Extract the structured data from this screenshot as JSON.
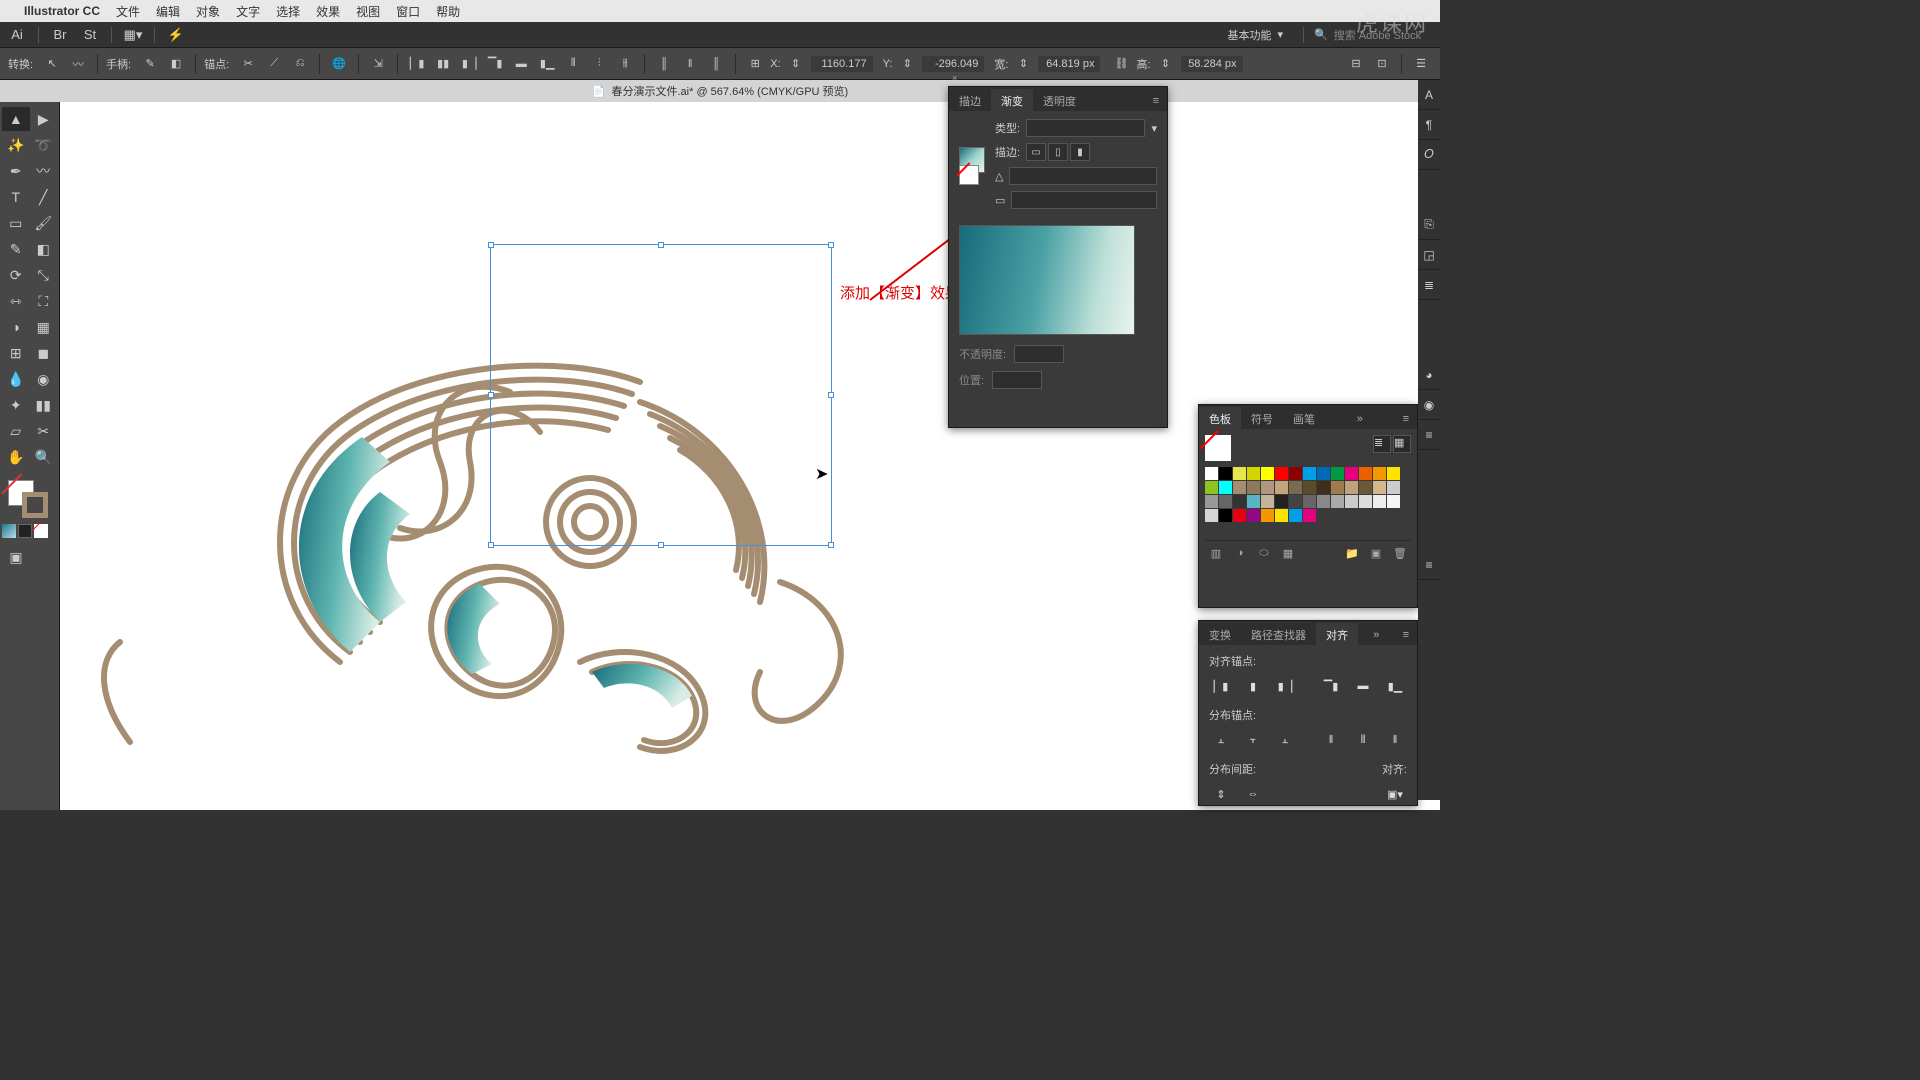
{
  "menubar": {
    "app": "Illustrator CC",
    "items": [
      "文件",
      "编辑",
      "对象",
      "文字",
      "选择",
      "效果",
      "视图",
      "窗口",
      "帮助"
    ]
  },
  "topbar": {
    "workspace": "基本功能",
    "search_placeholder": "搜索 Adobe Stock"
  },
  "ctrlbar": {
    "transform": "转换:",
    "handle": "手柄:",
    "anchor": "锚点:",
    "x_label": "X:",
    "x": "1160.177",
    "y_label": "Y:",
    "y": "-296.049",
    "w_label": "宽:",
    "w": "64.819 px",
    "h_label": "高:",
    "h": "58.284 px"
  },
  "doc": {
    "title": "春分演示文件.ai* @ 567.64% (CMYK/GPU 预览)"
  },
  "annotation": "添加【渐变】效果",
  "gradient_panel": {
    "tab_stroke": "描边",
    "tab_gradient": "渐变",
    "tab_opacity": "透明度",
    "type_label": "类型:",
    "stroke_label": "描边:",
    "opacity_label": "不透明度:",
    "position_label": "位置:"
  },
  "swatch_panel": {
    "tab_swatches": "色板",
    "tab_symbols": "符号",
    "tab_brushes": "画笔"
  },
  "align_panel": {
    "tab_transform": "变换",
    "tab_pathfinder": "路径查找器",
    "tab_align": "对齐",
    "align_anchor": "对齐锚点:",
    "distribute_anchor": "分布锚点:",
    "distribute_spacing": "分布间距:",
    "align_to": "对齐:"
  },
  "watermark": "虎课网",
  "swatch_colors": [
    "#ffffff",
    "#000000",
    "#e6e64d",
    "#d4d400",
    "#ffff00",
    "#ff0000",
    "#8b0000",
    "#00a0e9",
    "#0068b7",
    "#009944",
    "#e4007f",
    "#eb6100",
    "#f39800",
    "#ffe200",
    "#8fc31f",
    "#00ffff",
    "#a58d72",
    "#8e7a5b",
    "#b2967d",
    "#c4a57b",
    "#7a6a4f",
    "#5c4b2a",
    "#3e2e1a",
    "#9e7b4f",
    "#bfa27a",
    "#6b5a3a",
    "#d3b88c",
    "#cccccc",
    "#999999",
    "#666666",
    "#333333",
    "#5ab4c4",
    "#c4b59a",
    "#222222",
    "#444444",
    "#666666",
    "#888888",
    "#aaaaaa",
    "#cccccc",
    "#dddddd",
    "#eeeeee",
    "#f5f5f5",
    "#d4d4d4",
    "#000000",
    "#e60012",
    "#920783",
    "#f39800",
    "#ffe200",
    "#00a0e9",
    "#e4007f"
  ]
}
